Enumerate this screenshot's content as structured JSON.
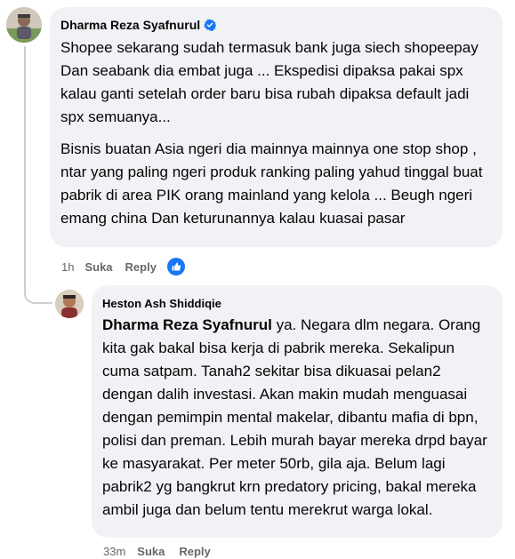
{
  "comment": {
    "author": "Dharma Reza Syafnurul",
    "paragraphs": [
      "Shopee sekarang sudah termasuk bank juga siech shopeepay Dan seabank dia embat juga ... Ekspedisi dipaksa pakai spx kalau ganti setelah order baru bisa rubah dipaksa default jadi spx semuanya...",
      "Bisnis buatan Asia ngeri dia mainnya mainnya one stop shop , ntar yang paling ngeri produk ranking paling yahud tinggal buat pabrik di area PIK orang mainland yang kelola ... Beugh ngeri emang china Dan keturunannya kalau kuasai pasar"
    ],
    "time": "1h",
    "like_label": "Suka",
    "reply_label": "Reply"
  },
  "reply": {
    "author": "Heston Ash Shiddiqie",
    "mention": "Dharma Reza Syafnurul",
    "text": " ya. Negara dlm negara. Orang kita gak bakal bisa kerja di pabrik mereka. Sekalipun cuma satpam. Tanah2 sekitar bisa dikuasai pelan2 dengan dalih investasi. Akan makin mudah menguasai dengan pemimpin mental makelar, dibantu mafia di bpn, polisi dan preman. Lebih murah bayar mereka drpd bayar ke masyarakat. Per meter 50rb, gila aja. Belum lagi pabrik2 yg bangkrut krn predatory pricing, bakal mereka ambil juga dan belum tentu merekrut warga lokal.",
    "time": "33m",
    "like_label": "Suka",
    "reply_label": "Reply"
  },
  "colors": {
    "bubble": "#f0f2f5",
    "meta": "#65676b",
    "accent": "#1877f2"
  },
  "icons": {
    "verified": "verified-badge-icon",
    "reaction": "like-thumb-icon"
  }
}
